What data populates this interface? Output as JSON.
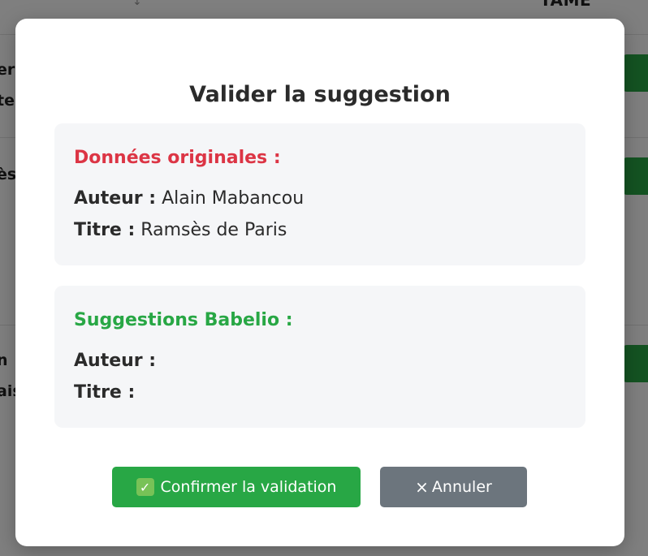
{
  "background": {
    "sort_arrow": "↓",
    "column_header": "TAME",
    "rows": [
      {
        "lines": [
          "er",
          "te"
        ]
      },
      {
        "lines": [
          "ès"
        ]
      },
      {
        "lines": [
          "n",
          "ais"
        ]
      }
    ]
  },
  "modal": {
    "title": "Valider la suggestion",
    "original": {
      "heading": "Données originales :",
      "author_label": "Auteur :",
      "author_value": "Alain Mabancou",
      "title_label": "Titre :",
      "title_value": "Ramsès de Paris"
    },
    "suggestion": {
      "heading": "Suggestions Babelio :",
      "author_label": "Auteur :",
      "author_value": "",
      "title_label": "Titre :",
      "title_value": ""
    },
    "confirm_button": {
      "icon": "check-icon",
      "label": "Confirmer la validation"
    },
    "cancel_button": {
      "icon": "close-icon",
      "label": "Annuler"
    }
  },
  "colors": {
    "danger": "#dc3545",
    "success": "#28a745",
    "secondary": "#6c757d"
  }
}
